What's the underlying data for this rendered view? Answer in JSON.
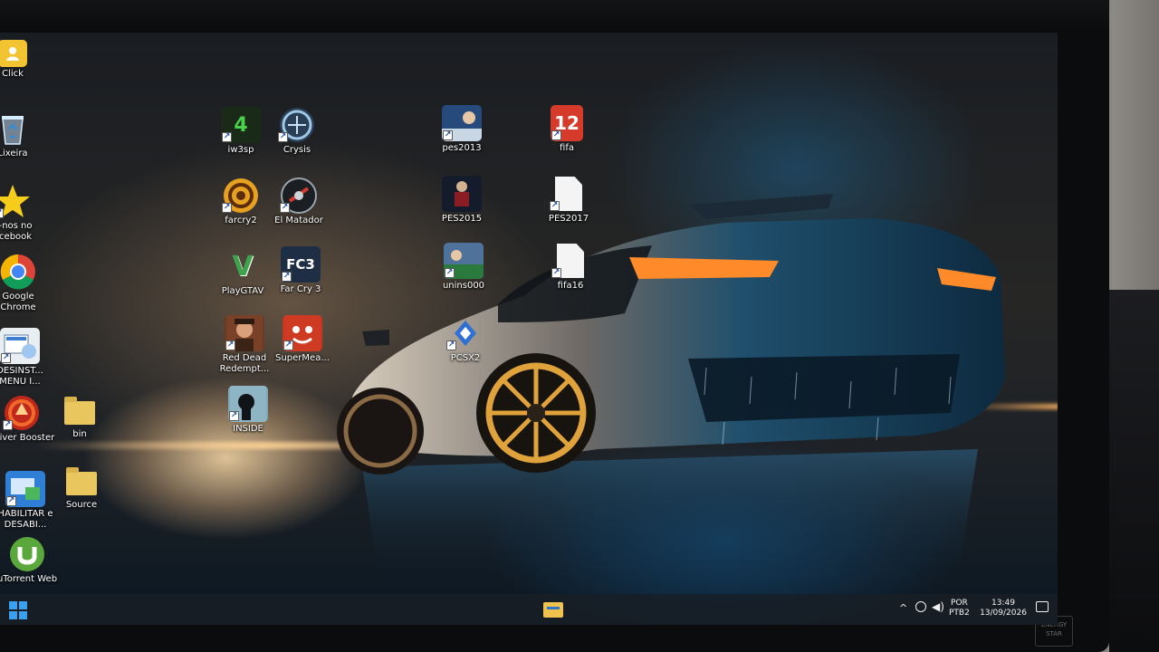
{
  "desktop": {
    "left_column": [
      {
        "label": "Click",
        "icon": "user-folder-icon"
      },
      {
        "label": "Lixeira",
        "icon": "recycle-bin-icon"
      },
      {
        "label": "a-nos no acebook",
        "icon": "star-icon"
      },
      {
        "label": "Google Chrome",
        "icon": "chrome-icon"
      },
      {
        "label": "DESINST... MENU I...",
        "icon": "uninstall-menu-icon"
      },
      {
        "label": "Driver Booster",
        "icon": "driver-booster-icon"
      },
      {
        "label": "HABILITAR e DESABI...",
        "icon": "enable-disable-icon"
      },
      {
        "label": "uTorrent Web",
        "icon": "utorrent-icon"
      }
    ],
    "folders": [
      {
        "label": "bin",
        "icon": "folder-icon"
      },
      {
        "label": "Source",
        "icon": "folder-icon"
      }
    ],
    "games_col1": [
      {
        "label": "iw3sp",
        "icon": "cod4-icon",
        "text": "4"
      },
      {
        "label": "farcry2",
        "icon": "farcry2-icon"
      },
      {
        "label": "PlayGTAV",
        "icon": "gta-v-icon",
        "text": "V"
      },
      {
        "label": "Red Dead Redempt...",
        "icon": "red-dead-icon"
      },
      {
        "label": "INSIDE",
        "icon": "inside-icon"
      }
    ],
    "games_col2": [
      {
        "label": "Crysis",
        "icon": "crysis-icon"
      },
      {
        "label": "El Matador",
        "icon": "el-matador-icon"
      },
      {
        "label": "Far Cry 3",
        "icon": "farcry3-icon",
        "text": "FC3"
      },
      {
        "label": "SuperMea...",
        "icon": "super-meat-boy-icon"
      }
    ],
    "games_col3": [
      {
        "label": "pes2013",
        "icon": "pes2013-icon"
      },
      {
        "label": "PES2015",
        "icon": "pes2015-icon"
      },
      {
        "label": "unins000",
        "icon": "uninstaller-icon"
      },
      {
        "label": "PCSX2",
        "icon": "pcsx2-icon"
      }
    ],
    "games_col4": [
      {
        "label": "fifa",
        "icon": "fifa12-icon",
        "text": "12"
      },
      {
        "label": "PES2017",
        "icon": "blank-file-icon"
      },
      {
        "label": "fifa16",
        "icon": "blank-file-icon"
      }
    ]
  },
  "taskbar": {
    "language": "POR",
    "layout": "PTB2",
    "time": "13:49",
    "date": "13/09/2026"
  },
  "monitor": {
    "badge": "ENERGY STAR"
  }
}
